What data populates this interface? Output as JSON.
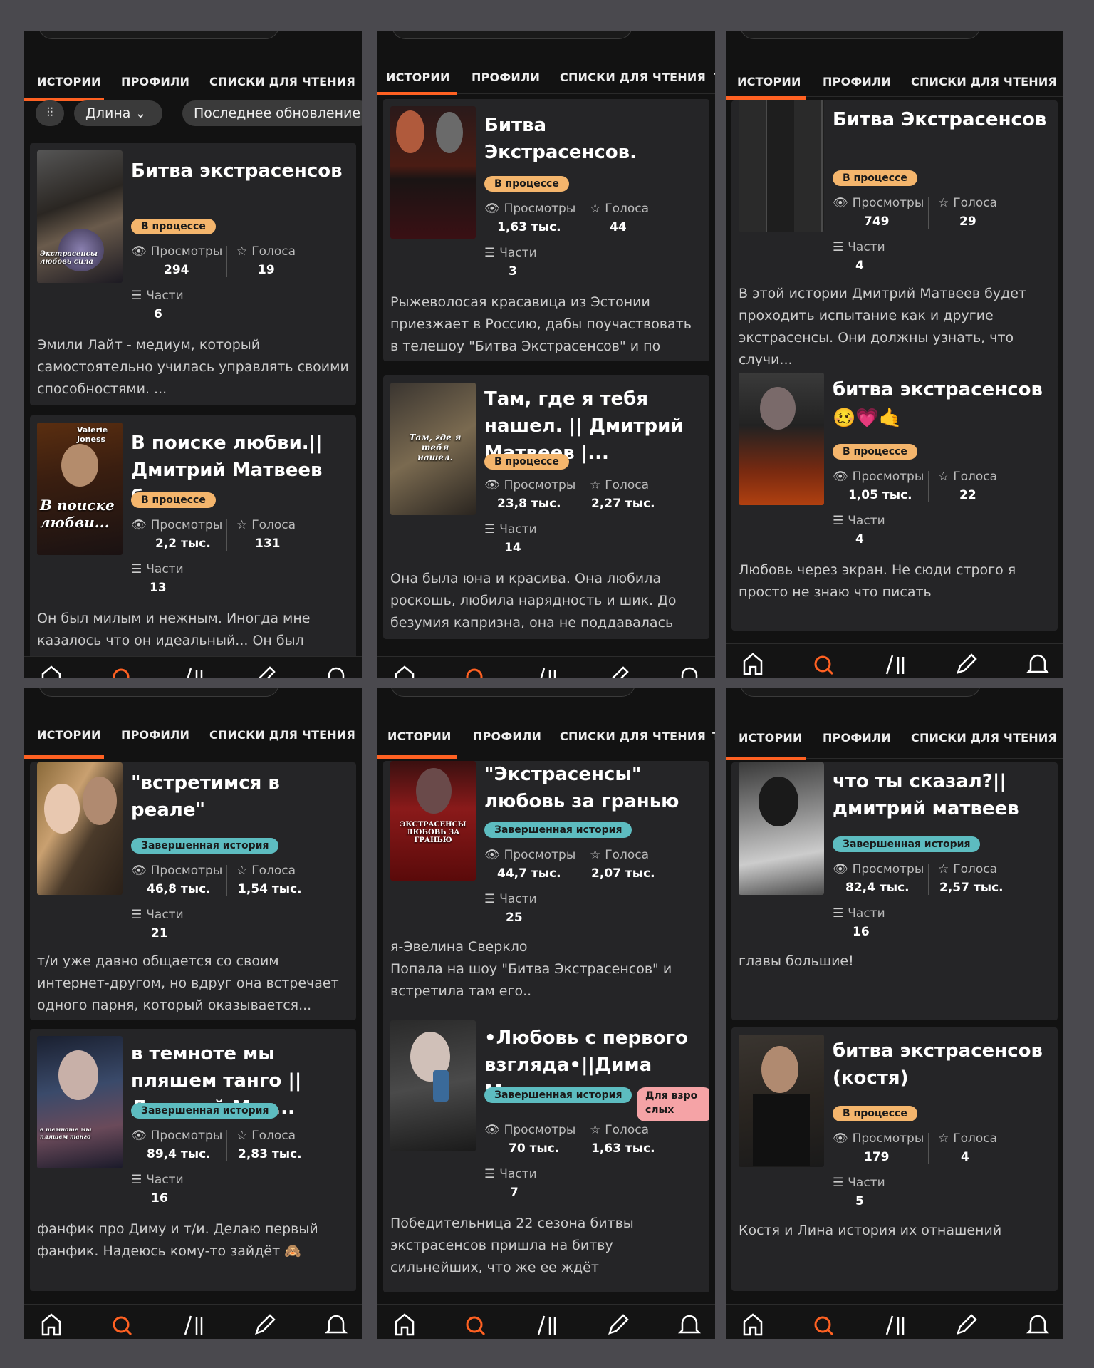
{
  "tabs": [
    "ИСТОРИИ",
    "ПРОФИЛИ",
    "СПИСКИ ДЛЯ ЧТЕНИЯ",
    "Т"
  ],
  "filters": {
    "length": "Длина",
    "sort": "Последнее обновление"
  },
  "labels": {
    "views": "Просмотры",
    "votes": "Голоса",
    "parts": "Части"
  },
  "status": {
    "progress": "В процессе",
    "done": "Завершенная история",
    "mature": "Для взрослых"
  },
  "colors": {
    "accent": "#ff6122",
    "progress": "#f4b56c",
    "done": "#5dbcc0",
    "mature": "#f5a3a6"
  },
  "panels": [
    {
      "cards": [
        {
          "title": "Битва экстрасенсов",
          "status": "В процессе",
          "views": "294",
          "votes": "19",
          "parts": "6",
          "desc": "Эмили Лайт - медиум, который самостоятельно училась управлять своими способностями. ...",
          "cover_text": "Экстрасенсы любовь сила"
        },
        {
          "title": "В поиске любви.|| Дмитрий Матвеев б...",
          "status": "В процессе",
          "views": "2,2 тыс.",
          "votes": "131",
          "parts": "13",
          "desc": "Он был милым и нежным. Иногда мне казалось что он идеальный... Он был лучше",
          "cover_text": "В поиске любви...",
          "cover_author": "Valerie Joness"
        }
      ]
    },
    {
      "cards": [
        {
          "title": "Битва Экстрасенсов.",
          "status": "В процессе",
          "views": "1,63 тыс.",
          "votes": "44",
          "parts": "3",
          "desc": "Рыжеволосая красавица из Эстонии приезжает в Россию, дабы поучаствовать в телешоу \"Битва Экстрасенсов\" и по возмо..."
        },
        {
          "title": "Там, где я тебя нашел. || Дмитрий Матвеев |...",
          "status": "В процессе",
          "views": "23,8 тыс.",
          "votes": "2,27 тыс.",
          "parts": "14",
          "desc": "Она была юна и красива. Она любила роскошь, любила нарядность и шик. До безумия капризна, она не поддавалась пере...",
          "cover_text": "Там, где я тебя нашел."
        }
      ]
    },
    {
      "cards": [
        {
          "title": "Битва Экстрасенсов",
          "status": "В процессе",
          "views": "749",
          "votes": "29",
          "parts": "4",
          "desc": "В этой истории Дмитрий Матвеев будет проходить испытание как и другие экстрасенсы. Они должны узнать, что случи..."
        },
        {
          "title": "битва экстрасенсов 🥴💗🤙",
          "status": "В процессе",
          "views": "1,05 тыс.",
          "votes": "22",
          "parts": "4",
          "desc": "Любовь через экран. Не сюди строго я просто не знаю что писать"
        }
      ]
    },
    {
      "cards": [
        {
          "title": "\"встретимся в реале\"",
          "status": "Завершенная история",
          "views": "46,8 тыс.",
          "votes": "1,54 тыс.",
          "parts": "21",
          "desc": "т/и уже давно общается со своим интернет-другом, но вдруг она встречает одного парня, который оказывается..."
        },
        {
          "title": "в темноте мы пляшем танго ||Дмитрий Мат...",
          "status": "Завершенная история",
          "views": "89,4 тыс.",
          "votes": "2,83 тыс.",
          "parts": "16",
          "desc": "фанфик про Диму и т/и. Делаю первый фанфик. Надеюсь кому-то зайдёт 🙈",
          "cover_text": "в темноте мы пляшем танго"
        }
      ]
    },
    {
      "cards": [
        {
          "title": "\"Экстрасенсы\" любовь за гранью",
          "status": "Завершенная история",
          "views": "44,7 тыс.",
          "votes": "2,07 тыс.",
          "parts": "25",
          "desc": "я-Эвелина Сверкло\n Попала на шоу \"Битва Экстрасенсов\" и встретила там его..",
          "cover_text": "ЭКСТРАСЕНСЫ ЛЮБОВЬ ЗА ГРАНЬЮ"
        },
        {
          "title": "•Любовь с первого взгляда•||Дима Матв...",
          "status": "Завершенная история",
          "mature": "Для взро слых",
          "views": "70 тыс.",
          "votes": "1,63 тыс.",
          "parts": "7",
          "desc": "Победительница 22 сезона битвы экстрасенсов пришла на битву сильнейших, что же ее ждёт"
        }
      ]
    },
    {
      "cards": [
        {
          "title": "что ты сказал?|| дмитрий матвеев",
          "status": "Завершенная история",
          "views": "82,4 тыс.",
          "votes": "2,57 тыс.",
          "parts": "16",
          "desc": "главы большие!"
        },
        {
          "title": "битва экстрасенсов (костя)",
          "status": "В процессе",
          "views": "179",
          "votes": "4",
          "parts": "5",
          "desc": "Костя и Лина история их отнашений"
        }
      ]
    }
  ]
}
